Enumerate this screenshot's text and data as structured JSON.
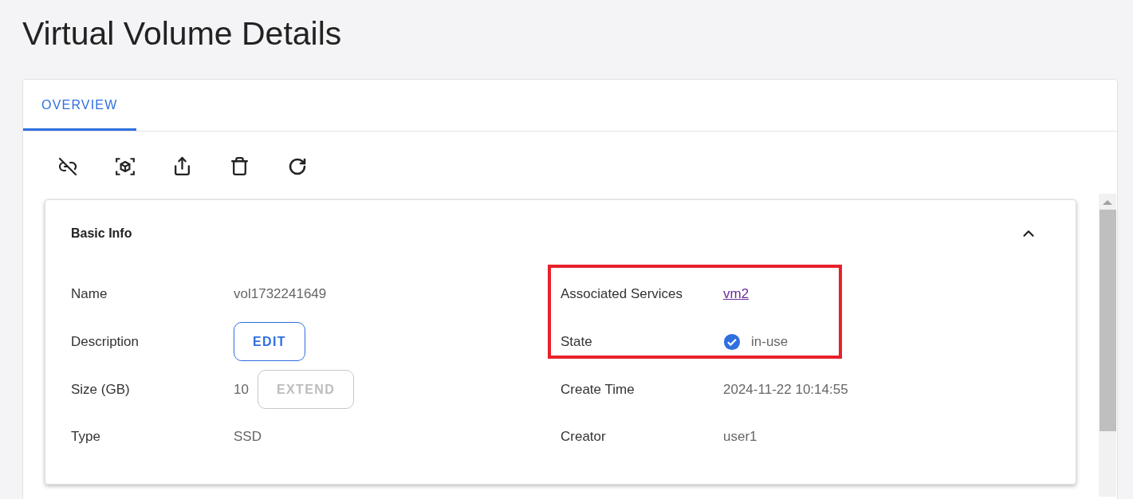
{
  "page": {
    "title": "Virtual Volume Details"
  },
  "tabs": [
    {
      "label": "OVERVIEW",
      "selected": true
    }
  ],
  "basic_info": {
    "title": "Basic Info",
    "expanded": true,
    "highlight_frame": true,
    "fields": [
      {
        "label": "Name",
        "kind": "text",
        "value": "vol1732241649"
      },
      {
        "label": "Associated Services",
        "kind": "link",
        "value": "vm2"
      },
      {
        "label": "Description",
        "kind": "button",
        "button": {
          "label": "EDIT",
          "disabled": false
        }
      },
      {
        "label": "State",
        "kind": "status",
        "value": "in-use"
      },
      {
        "label": "Size (GB)",
        "kind": "text_button",
        "value": "10",
        "button": {
          "label": "EXTEND",
          "disabled": true
        }
      },
      {
        "label": "Create Time",
        "kind": "text",
        "value": "2024-11-22 10:14:55"
      },
      {
        "label": "Type",
        "kind": "text",
        "value": "SSD"
      },
      {
        "label": "Creator",
        "kind": "text",
        "value": "user1"
      }
    ]
  }
}
